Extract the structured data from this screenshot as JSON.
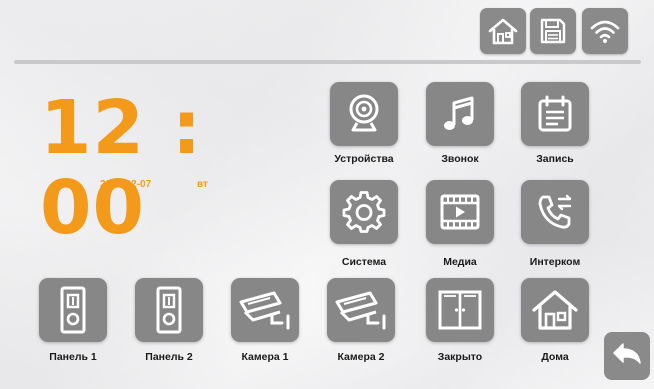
{
  "clock": {
    "time": "12 : 00",
    "date": "2021-12-07",
    "weekday": "вт"
  },
  "toolbar": [
    {
      "icon": "home-icon"
    },
    {
      "icon": "save-icon"
    },
    {
      "icon": "wifi-icon"
    }
  ],
  "menu": [
    {
      "label": "Устройства",
      "icon": "webcam-icon"
    },
    {
      "label": "Звонок",
      "icon": "music-note-icon"
    },
    {
      "label": "Запись",
      "icon": "calendar-icon"
    },
    {
      "label": "Система",
      "icon": "gear-icon"
    },
    {
      "label": "Медиа",
      "icon": "film-play-icon"
    },
    {
      "label": "Интерком",
      "icon": "phone-transfer-icon"
    }
  ],
  "quick": [
    {
      "label": "Панель 1",
      "icon": "door-panel-icon"
    },
    {
      "label": "Панель 2",
      "icon": "door-panel-icon"
    },
    {
      "label": "Камера 1",
      "icon": "cctv-camera-icon"
    },
    {
      "label": "Камера 2",
      "icon": "cctv-camera-icon"
    },
    {
      "label": "Закрыто",
      "icon": "closed-door-icon"
    },
    {
      "label": "Дома",
      "icon": "home-icon"
    }
  ],
  "back": {
    "icon": "back-arrow-icon"
  },
  "colors": {
    "accent": "#f39a1b",
    "tile": "#878787",
    "icon": "#ffffff"
  }
}
